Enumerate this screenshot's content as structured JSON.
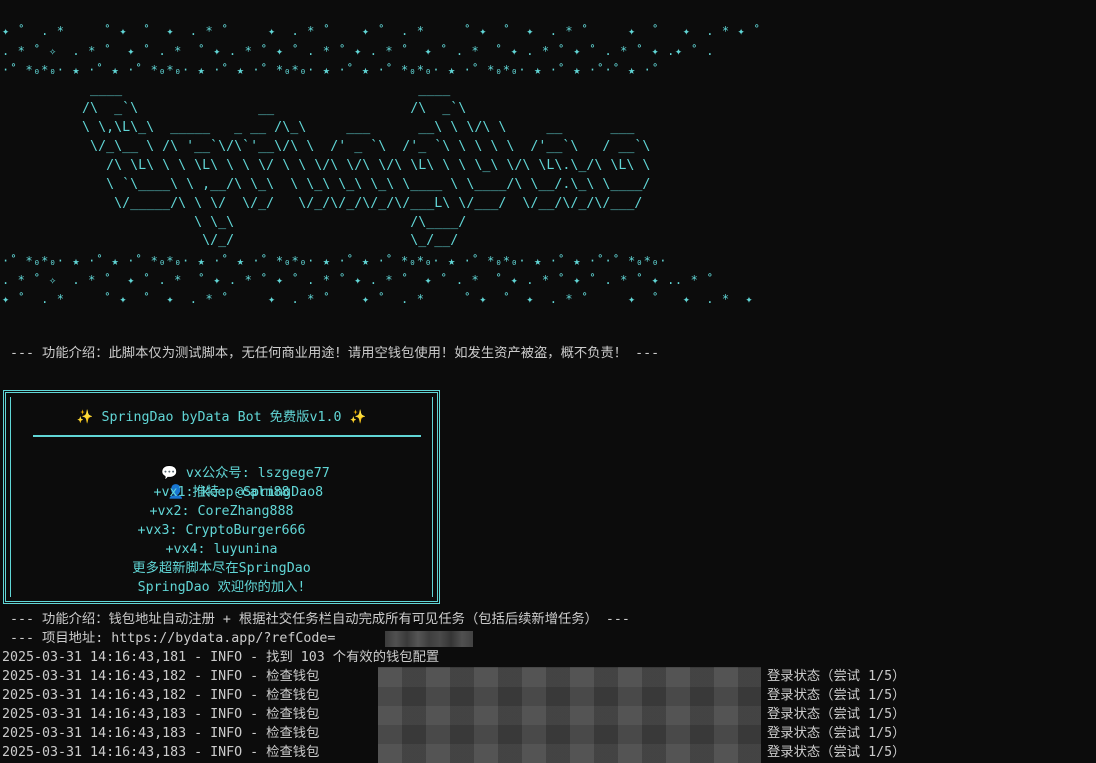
{
  "star_rows_top": [
    "✦ ˚  . *     ˚ ✦  ˚  ✦  . * ˚     ✦  . * ˚    ✦ ˚  . *     ˚ ✦  ˚  ✦  . * ˚     ✦  ˚   ✦  . * ✦ ˚",
    ". * ˚ ✧  . * ˚  ✦ ˚ . *  ˚ ✦ . * ˚ ✦ ˚ . * ˚ ✦ . * ˚  ✦ ˚ . *  ˚ ✦ . * ˚ ✦ ˚ . * ˚ ✦ .✦ ˚ .",
    "·˚ *₀*₀· ★ ·˚ ★ ·˚ *₀*₀· ★ ·˚ ★ ·˚ *₀*₀· ★ ·˚ ★ ·˚ *₀*₀· ★ ·˚ *₀*₀· ★ ·˚ ★ ·˚·˚ ★ ·˚"
  ],
  "ascii_art": [
    "           ____                                     ____",
    "          /\\  _`\\               __                 /\\  _`\\",
    "          \\ \\,\\L\\_\\  _____   _ __ /\\_\\     ___      __\\ \\ \\/\\ \\     __      ___",
    "           \\/_\\__ \\ /\\ '__`\\/\\`'__\\/\\ \\  /' _ `\\  /'_ `\\ \\ \\ \\ \\  /'__`\\   / __`\\",
    "             /\\ \\L\\ \\ \\ \\L\\ \\ \\ \\/ \\ \\ \\/\\ \\/\\ \\/\\ \\L\\ \\ \\ \\_\\ \\/\\ \\L\\.\\_/\\ \\L\\ \\",
    "             \\ `\\____\\ \\ ,__/\\ \\_\\  \\ \\_\\ \\_\\ \\_\\ \\____ \\ \\____/\\ \\__/.\\_\\ \\____/",
    "              \\/_____/\\ \\ \\/  \\/_/   \\/_/\\/_/\\/_/\\/___L\\ \\/___/  \\/__/\\/_/\\/___/",
    "                        \\ \\_\\                      /\\____/",
    "                         \\/_/                      \\_/__/"
  ],
  "star_rows_bottom": [
    "·˚ *₀*₀· ★ ·˚ ★ ·˚ *₀*₀· ★ ·˚ ★ ·˚ *₀*₀· ★ ·˚ ★ ·˚ *₀*₀· ★ ·˚ *₀*₀· ★ ·˚ ★ ·˚·˚ *₀*₀·",
    ". * ˚ ✧  . * ˚  ✦ ˚ . *  ˚ ✦ . * ˚ ✦ ˚ . * ˚ ✦ . * ˚  ✦ ˚ . *  ˚ ✦ . * ˚ ✦ ˚ . * ˚ ✦ .. * ˚",
    "✦ ˚  . *     ˚ ✦  ˚  ✦  . * ˚     ✦  . * ˚    ✦ ˚  . *     ˚ ✦  ˚  ✦  . * ˚     ✦  ˚   ✦  . *  ✦"
  ],
  "intro_line": " --- 功能介绍：此脚本仅为测试脚本，无任何商业用途！请用空钱包使用！如发生资产被盗，概不负责！ ---",
  "box": {
    "title_left_icon": "✨",
    "title": " SpringDao byData Bot 免费版v1.0 ",
    "title_right_icon": "✨",
    "speech_icon": "💬",
    "vx_public": " vx公众号: lszgege77",
    "person_icon": "👤",
    "twitter": " 推特: @SpringDao8",
    "vx1": "+vx1: keep-calm88",
    "vx2": "+vx2: CoreZhang888",
    "vx3": "+vx3: CryptoBurger666",
    "vx4": "+vx4: luyunina",
    "more": "更多超新脚本尽在SpringDao",
    "welcome": "SpringDao 欢迎你的加入!"
  },
  "feature_line": " --- 功能介绍：钱包地址自动注册 + 根据社交任务栏自动完成所有可见任务（包括后续新增任务） ---",
  "project_line": " --- 项目地址: https://bydata.app/?refCode=",
  "log_lines": [
    {
      "prefix": "2025-03-31 14:16:43,181 - INFO - 找到 103 个有效的钱包配置",
      "suffix": ""
    },
    {
      "prefix": "2025-03-31 14:16:43,182 - INFO - 检查钱包 ",
      "suffix": "登录状态（尝试 1/5）"
    },
    {
      "prefix": "2025-03-31 14:16:43,182 - INFO - 检查钱包 ",
      "suffix": "登录状态（尝试 1/5）"
    },
    {
      "prefix": "2025-03-31 14:16:43,183 - INFO - 检查钱包 ",
      "suffix": "登录状态（尝试 1/5）"
    },
    {
      "prefix": "2025-03-31 14:16:43,183 - INFO - 检查钱包 ",
      "suffix": "登录状态（尝试 1/5）"
    },
    {
      "prefix": "2025-03-31 14:16:43,183 - INFO - 检查钱包 ",
      "suffix": "登录状态（尝试 1/5）"
    }
  ],
  "colors": {
    "background": "#0c0c0c",
    "cyan": "#61d6d6",
    "text": "#cccccc"
  }
}
